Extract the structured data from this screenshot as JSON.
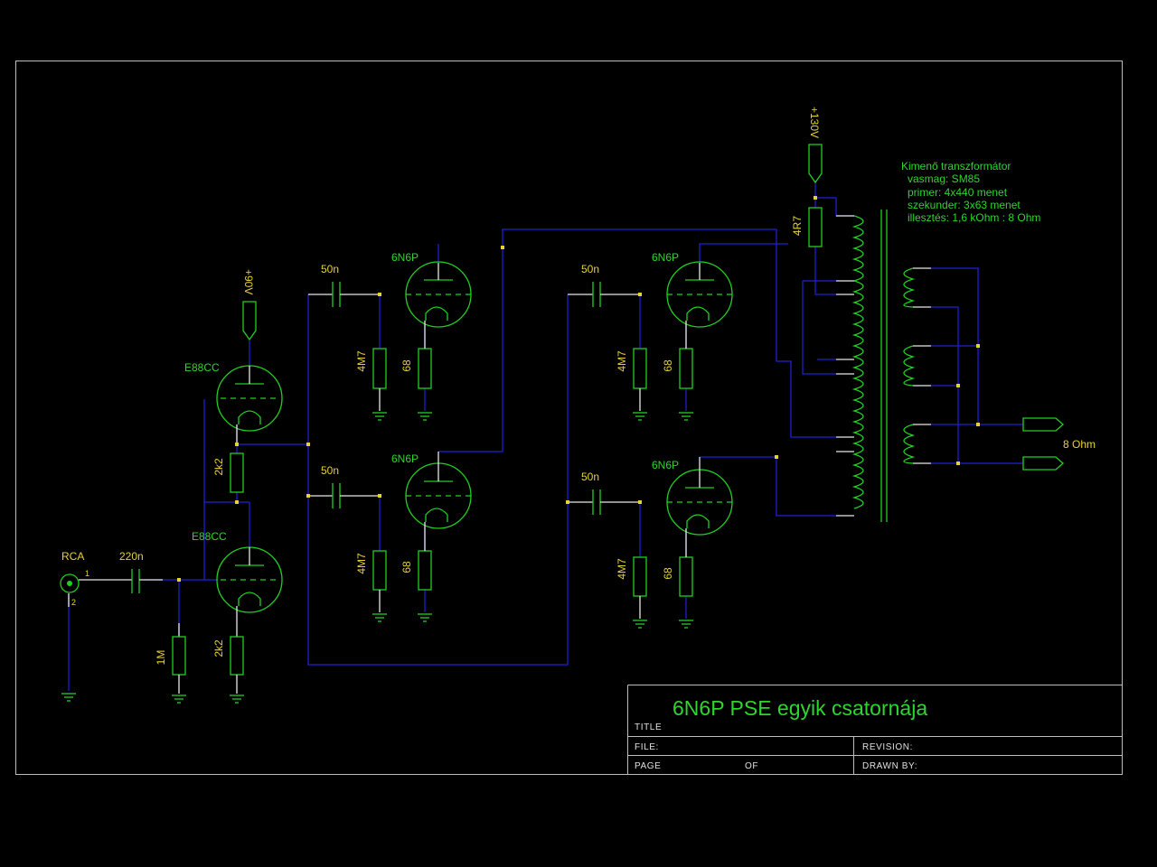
{
  "title_block": {
    "title": "6N6P PSE egyik csatornája",
    "title_label": "TITLE",
    "file_label": "FILE:",
    "revision_label": "REVISION:",
    "page_label": "PAGE",
    "of_label": "OF",
    "drawn_by_label": "DRAWN BY:"
  },
  "connector": {
    "label": "RCA",
    "pin1": "1",
    "pin2": "2"
  },
  "tubes": {
    "driver": "E88CC",
    "output": "6N6P"
  },
  "components": {
    "c_input": "220n",
    "r_grid_input": "1M",
    "r_cathode": "2k2",
    "c_coupling": "50n",
    "r_grid": "4M7",
    "r_cathode_out": "68",
    "r_supply": "4R7"
  },
  "supplies": {
    "driver": "+90V",
    "output": "+130V"
  },
  "transformer": {
    "title": "Kimenő transzformátor",
    "lines": [
      "vasmag: SM85",
      "primer: 4x440 menet",
      "szekunder: 3x63 menet",
      "illesztés: 1,6 kOhm : 8 Ohm"
    ]
  },
  "output_label": "8 Ohm",
  "colors": {
    "background": "#000000",
    "wire": "#2020d0",
    "symbol": "#20d020",
    "label": "#e6d235",
    "frame": "#bdbdbd"
  }
}
